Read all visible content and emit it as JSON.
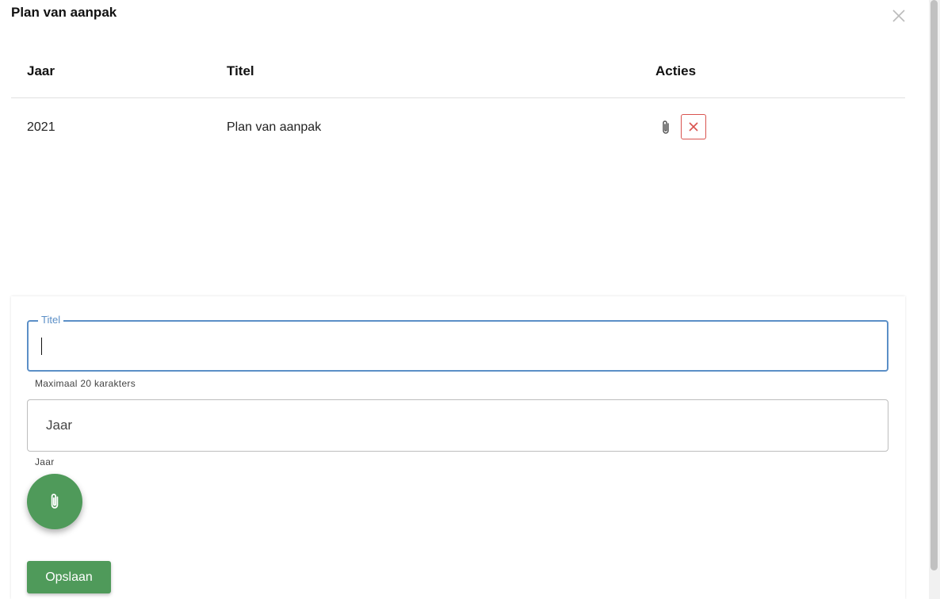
{
  "dialog": {
    "title": "Plan van aanpak"
  },
  "table": {
    "headers": {
      "jaar": "Jaar",
      "titel": "Titel",
      "acties": "Acties"
    },
    "rows": [
      {
        "jaar": "2021",
        "titel": "Plan van aanpak"
      }
    ]
  },
  "form": {
    "titel_label": "Titel",
    "titel_value": "",
    "titel_hint": "Maximaal 20 karakters",
    "jaar_placeholder": "Jaar",
    "jaar_hint": "Jaar",
    "save_label": "Opslaan"
  },
  "colors": {
    "accent_green": "#4f9a5a",
    "focus_blue": "#5b8fc7",
    "delete_red": "#d9534f"
  },
  "icons": {
    "close": "close-icon",
    "attach": "paperclip-icon",
    "delete": "x-icon"
  }
}
